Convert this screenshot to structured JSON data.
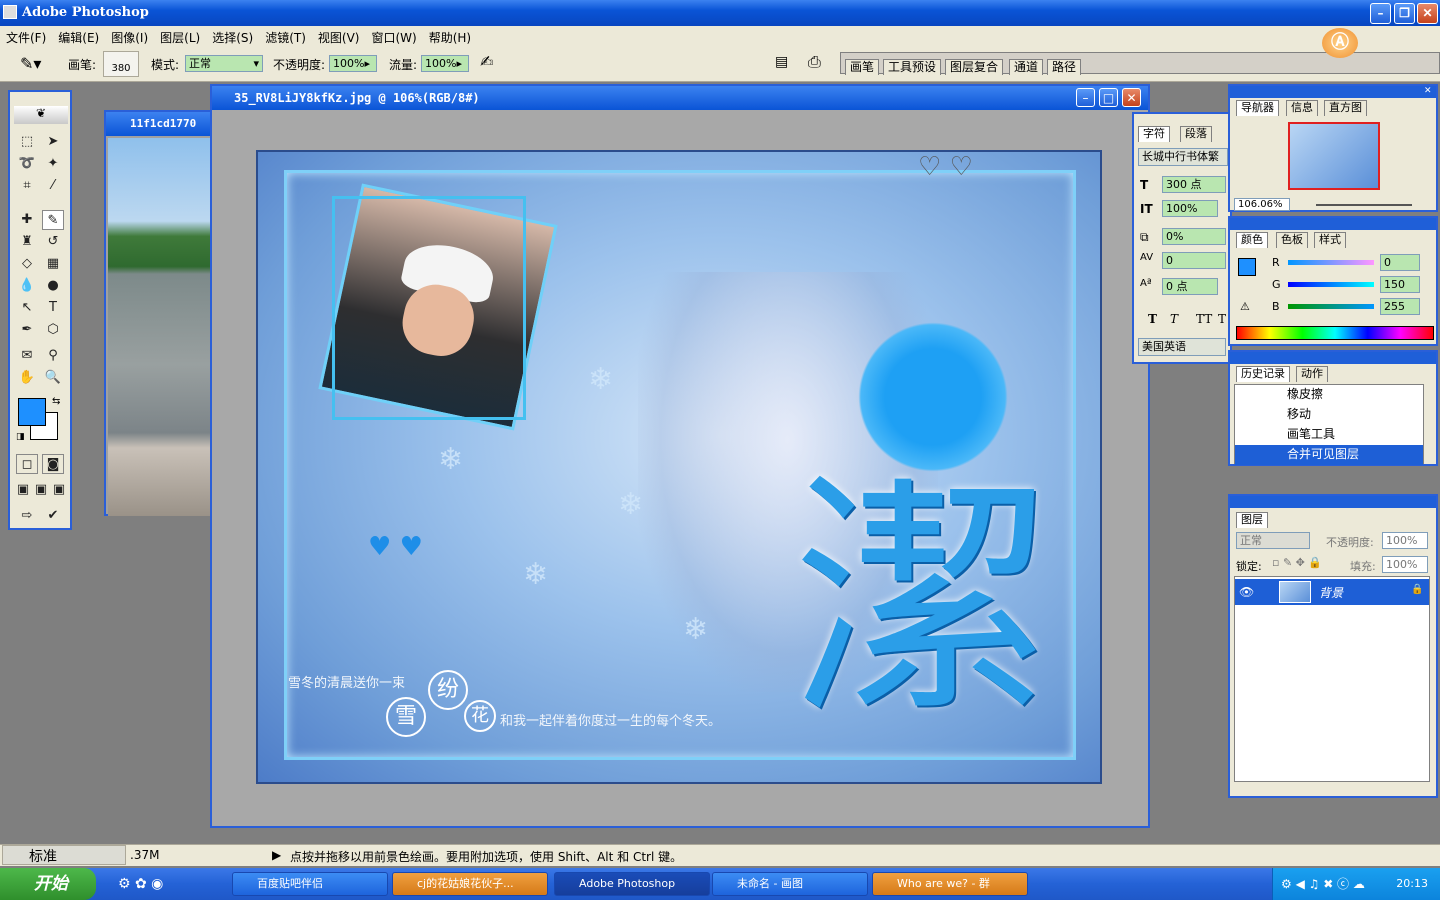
{
  "app": {
    "title": "Adobe Photoshop",
    "colors": {
      "accent": "#0a54d6",
      "fg_swatch": "#1e90ff"
    }
  },
  "menu": [
    "文件(F)",
    "编辑(E)",
    "图像(I)",
    "图层(L)",
    "选择(S)",
    "滤镜(T)",
    "视图(V)",
    "窗口(W)",
    "帮助(H)"
  ],
  "options": {
    "brush_label": "画笔:",
    "brush_size": "380",
    "mode_label": "模式:",
    "mode_value": "正常",
    "opacity_label": "不透明度:",
    "opacity_value": "100%",
    "flow_label": "流量:",
    "flow_value": "100%"
  },
  "palette_well": [
    "画笔",
    "工具预设",
    "图层复合",
    "通道",
    "路径"
  ],
  "documents": {
    "bg_doc": {
      "title": "11f1cd1770"
    },
    "main_doc": {
      "title": "35_RV8LiJY8kfKz.jpg @ 106%(RGB/8#)"
    }
  },
  "artwork": {
    "big_char": "潔",
    "line1": "雪冬的清晨送你一束",
    "c1": "雪",
    "c2": "纷",
    "c3": "花",
    "line2": "和我一起伴着你度过一生的每个冬天。"
  },
  "character_panel": {
    "tabs": [
      "字符",
      "段落"
    ],
    "font": "长城中行书体繁",
    "size": "300 点",
    "scale": "100%",
    "tracking": "0%",
    "kerning": "0",
    "baseline": "0 点",
    "styles": [
      "T",
      "T",
      "TT",
      "T"
    ],
    "language": "美国英语"
  },
  "navigator": {
    "tabs": [
      "导航器",
      "信息",
      "直方图"
    ],
    "zoom": "106.06%"
  },
  "color_panel": {
    "tabs": [
      "颜色",
      "色板",
      "样式"
    ],
    "r": "0",
    "g": "150",
    "b": "255",
    "r_label": "R",
    "g_label": "G",
    "b_label": "B"
  },
  "history_panel": {
    "tabs": [
      "历史记录",
      "动作"
    ],
    "items": [
      "橡皮擦",
      "移动",
      "画笔工具",
      "合并可见图层"
    ]
  },
  "layers_panel": {
    "tab": "图层",
    "mode": "正常",
    "opacity_label": "不透明度:",
    "opacity": "100%",
    "lock_label": "锁定:",
    "fill_label": "填充:",
    "fill": "100%",
    "layer_name": "背景"
  },
  "status": {
    "ime": "标准",
    "size": ".37M",
    "hint": "点按并拖移以用前景色绘画。要用附加选项，使用 Shift、Alt 和 Ctrl 键。"
  },
  "taskbar": {
    "start": "开始",
    "tasks": [
      "百度贴吧伴侣",
      "cj的花姑娘花伙子...",
      "Adobe Photoshop",
      "未命名 - 画图",
      "Who are we? - 群"
    ],
    "time": "20:13"
  }
}
